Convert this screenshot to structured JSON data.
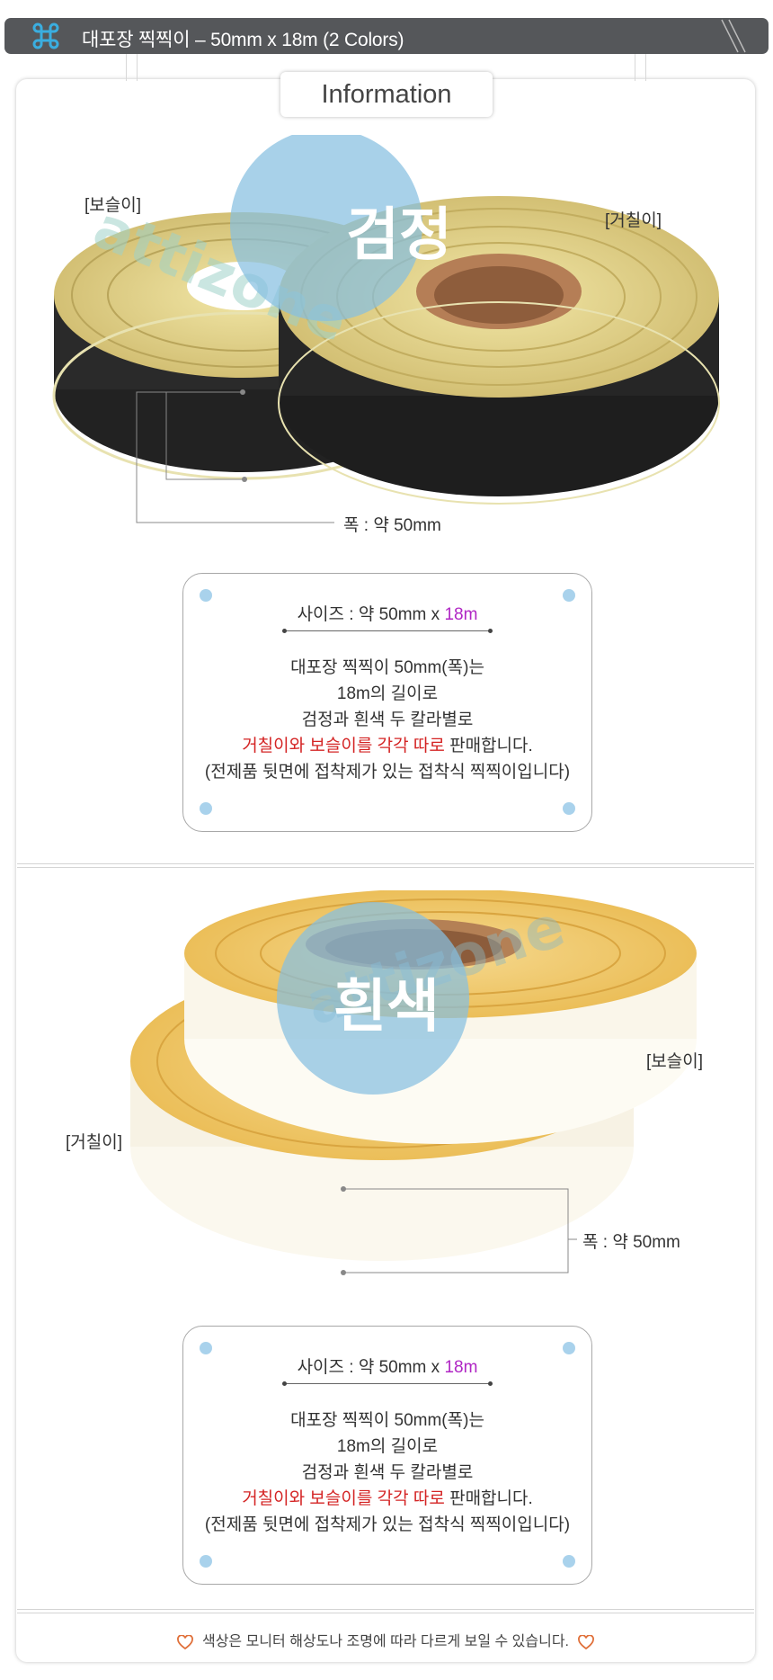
{
  "header": {
    "title": "대포장 찍찍이 – 50mm x 18m (2 Colors)",
    "icon": "command-icon"
  },
  "section_tab": "Information",
  "black_section": {
    "color_badge": "검정",
    "label_loop": "[보슬이]",
    "label_hook": "[거칠이]",
    "width_label": "폭 : 약 50mm",
    "watermark": "attizone"
  },
  "white_section": {
    "color_badge": "흰색",
    "label_loop": "[보슬이]",
    "label_hook": "[거칠이]",
    "width_label": "폭 : 약 50mm",
    "watermark": "attizone"
  },
  "info_box": {
    "size_prefix": "사이즈 : 약 50mm x ",
    "size_length": "18m",
    "line1": "대포장 찍찍이 50mm(폭)는",
    "line2": "18m의 길이로",
    "line3": "검정과 흰색 두 칼라별로",
    "line4_red": "거칠이와 보슬이를 각각 따로",
    "line4_rest": " 판매합니다.",
    "line5": "(전제품 뒷면에 접착제가 있는 접착식 찍찍이입니다)"
  },
  "footer": {
    "note": "색상은 모니터 해상도나 조명에 따라 다르게 보일 수 있습니다."
  },
  "colors": {
    "accent": "#b026c4",
    "highlight_red": "#d42424",
    "badge_blue": "#87bfe0",
    "header_bg": "#55575a"
  }
}
